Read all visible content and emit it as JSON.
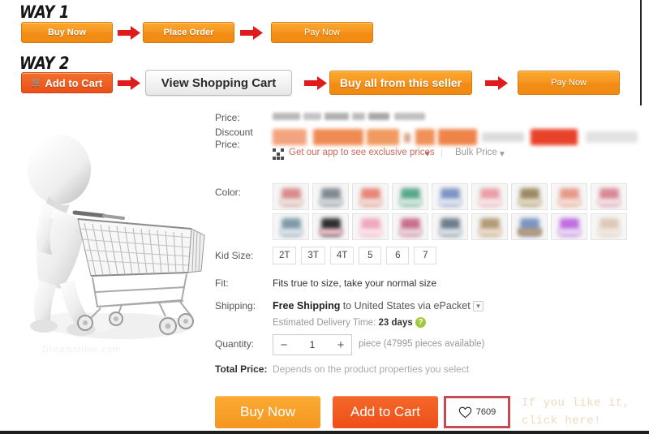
{
  "instructions": {
    "way1": {
      "label": "WAY 1",
      "steps": [
        {
          "text": "Buy Now",
          "style": "orange"
        },
        {
          "text": "Place Order",
          "style": "orange"
        },
        {
          "text": "Pay Now",
          "style": "orange"
        }
      ],
      "arrow_icon": "right-arrow-icon",
      "arrow_color": "#e01b1b"
    },
    "way2": {
      "label": "WAY 2",
      "steps": [
        {
          "text": "Add to Cart",
          "style": "red",
          "icon": "cart-icon"
        },
        {
          "text": "View Shopping Cart",
          "style": "grey"
        },
        {
          "text": "Buy all from this seller",
          "style": "orange"
        },
        {
          "text": "Pay Now",
          "style": "orange"
        }
      ]
    }
  },
  "photo": {
    "alt": "3d-figure-pushing-shopping-cart",
    "watermark": "Dreamstime.com"
  },
  "details": {
    "price": {
      "label": "Price:",
      "value_obscured": true
    },
    "discount_price": {
      "label_line1": "Discount",
      "label_line2": "Price:",
      "value_obscured": true
    },
    "app_promo": {
      "icon": "qr-code-icon",
      "text": "Get our app to see exclusive prices",
      "caret": "▾",
      "color": "#c96a5c"
    },
    "bulk_price": {
      "text": "Bulk Price",
      "caret": "▾"
    },
    "color": {
      "label": "Color:",
      "swatch_count": 18,
      "swatches": [
        {
          "c1": "#d98b8b",
          "c2": "#e8e0da"
        },
        {
          "c1": "#7f8a92",
          "c2": "#cfd3d6"
        },
        {
          "c1": "#e8857a",
          "c2": "#f0d8d2"
        },
        {
          "c1": "#5aa88a",
          "c2": "#cfe3da"
        },
        {
          "c1": "#7d95c4",
          "c2": "#dbe2ef"
        },
        {
          "c1": "#e8a0a6",
          "c2": "#f6e2e4"
        },
        {
          "c1": "#9b8a63",
          "c2": "#ded5bd"
        },
        {
          "c1": "#e79a8a",
          "c2": "#f3d9cf"
        },
        {
          "c1": "#d98896",
          "c2": "#f0dde1"
        },
        {
          "c1": "#7f9aa8",
          "c2": "#d6e0e6"
        },
        {
          "c1": "#2e2e2e",
          "c2": "#e3b8c3"
        },
        {
          "c1": "#f0a8bc",
          "c2": "#fae0e8"
        },
        {
          "c1": "#c96f8c",
          "c2": "#e6cfd7"
        },
        {
          "c1": "#6d7e8c",
          "c2": "#d5dce1"
        },
        {
          "c1": "#b39a78",
          "c2": "#e8d9c5"
        },
        {
          "c1": "#7b94c0",
          "c2": "#b59a7c"
        },
        {
          "c1": "#c06de0",
          "c2": "#e6d2f3"
        },
        {
          "c1": "#ddc9b8",
          "c2": "#f1e7df"
        }
      ]
    },
    "kid_size": {
      "label": "Kid Size:",
      "options": [
        "2T",
        "3T",
        "4T",
        "5",
        "6",
        "7"
      ]
    },
    "fit": {
      "label": "Fit:",
      "value": "Fits true to size, take your normal size"
    },
    "shipping": {
      "label": "Shipping:",
      "free_text": "Free Shipping",
      "dest_text": "to United States via ePacket",
      "caret_icon": "chevron-down-icon",
      "eta_label": "Estimated Delivery Time:",
      "eta_value": "23 days",
      "help_icon": "question-mark-icon"
    },
    "quantity": {
      "label": "Quantity:",
      "minus": "−",
      "value": "1",
      "plus": "+",
      "unit_text": "piece (47995 pieces available)"
    },
    "total_price": {
      "label": "Total Price:",
      "value": "Depends on the product properties you select"
    },
    "actions": {
      "buy_now": "Buy Now",
      "add_to_cart": "Add to Cart",
      "wishlist_icon": "heart-icon",
      "wishlist_count": "7609",
      "hint_line1": "If you like it,",
      "hint_line2": "click here!",
      "hint_color": "#f0d9c0",
      "highlight_color": "#c64c52"
    }
  }
}
